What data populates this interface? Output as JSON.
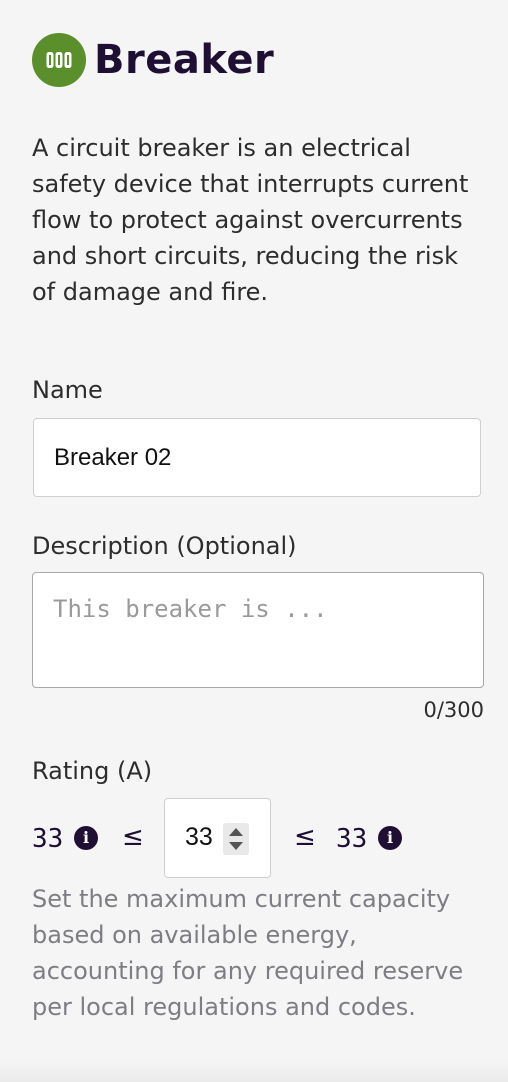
{
  "colors": {
    "accent": "#5a8f2c",
    "title": "#1f0f33",
    "help_text": "#7d7d84"
  },
  "header": {
    "icon": "breaker-icon",
    "title": "Breaker"
  },
  "description": "A circuit breaker is an electrical safety device that interrupts current flow to protect against overcurrents and short circuits, reducing the risk of damage and fire.",
  "name_field": {
    "label": "Name",
    "value": "Breaker 02"
  },
  "description_field": {
    "label": "Description (Optional)",
    "placeholder": "This breaker is ...",
    "value": "",
    "counter": "0/300"
  },
  "rating": {
    "label": "Rating (A)",
    "min": "33",
    "leq": "≤",
    "value": "33",
    "max": "33",
    "info_icon": "info-icon",
    "help": "Set the maximum current capacity based on available energy, accounting for any required reserve per local regulations and codes."
  }
}
